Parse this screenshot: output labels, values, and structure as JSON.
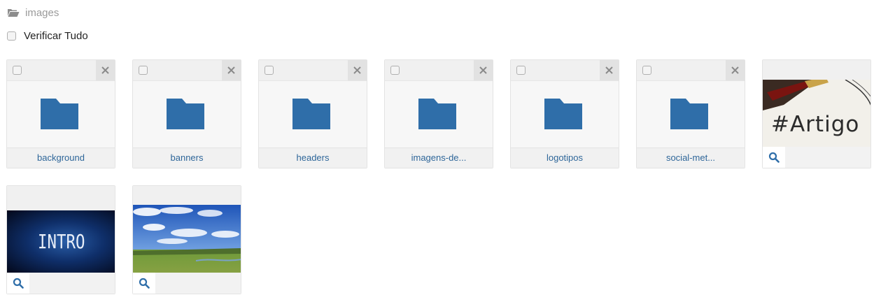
{
  "breadcrumb": {
    "label": "images",
    "icon": "folder-open-icon"
  },
  "check_all": {
    "label": "Verificar Tudo"
  },
  "folders": [
    {
      "name": "background"
    },
    {
      "name": "banners"
    },
    {
      "name": "headers"
    },
    {
      "name": "imagens-de..."
    },
    {
      "name": "logotipos"
    },
    {
      "name": "social-met..."
    }
  ],
  "images": [
    {
      "overlay_text": "#Artigo"
    },
    {
      "overlay_text": "INTRO"
    },
    {
      "overlay_text": ""
    }
  ],
  "colors": {
    "folder": "#2f6ea9",
    "label_text": "#2e6699",
    "zoom_icon": "#2f6ea9"
  }
}
